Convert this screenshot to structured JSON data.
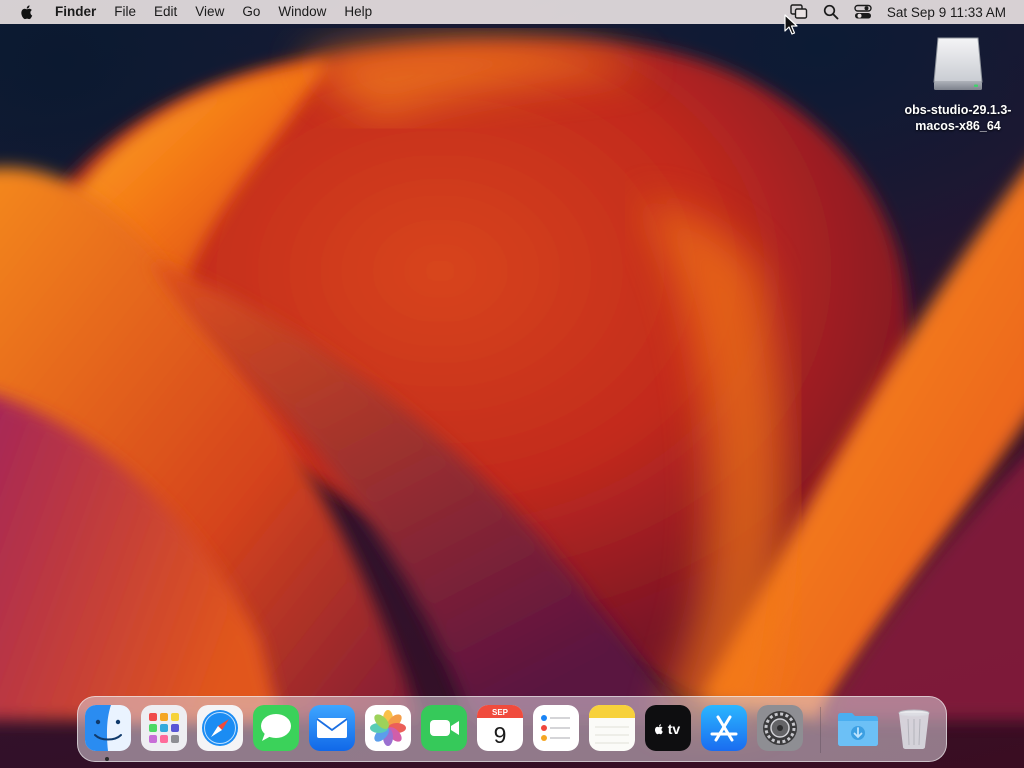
{
  "menubar": {
    "app_name": "Finder",
    "menus": [
      "File",
      "Edit",
      "View",
      "Go",
      "Window",
      "Help"
    ],
    "clock": "Sat Sep 9  11:33 AM",
    "status_icons": [
      "screen-mirroring-icon",
      "spotlight-search-icon",
      "control-center-icon"
    ]
  },
  "desktop": {
    "items": [
      {
        "label": "obs-studio-29.1.3-macos-x86_64",
        "icon": "disk-image-icon"
      }
    ]
  },
  "dock": {
    "apps": [
      {
        "name": "Finder",
        "icon": "finder-icon",
        "running": true
      },
      {
        "name": "Launchpad",
        "icon": "launchpad-icon",
        "running": false
      },
      {
        "name": "Safari",
        "icon": "safari-icon",
        "running": false
      },
      {
        "name": "Messages",
        "icon": "messages-icon",
        "running": false
      },
      {
        "name": "Mail",
        "icon": "mail-icon",
        "running": false
      },
      {
        "name": "Photos",
        "icon": "photos-icon",
        "running": false
      },
      {
        "name": "FaceTime",
        "icon": "facetime-icon",
        "running": false
      },
      {
        "name": "Calendar",
        "icon": "calendar-icon",
        "running": false,
        "month": "SEP",
        "day": "9"
      },
      {
        "name": "Reminders",
        "icon": "reminders-icon",
        "running": false
      },
      {
        "name": "Notes",
        "icon": "notes-icon",
        "running": false
      },
      {
        "name": "TV",
        "icon": "apple-tv-icon",
        "running": false,
        "label": "tv"
      },
      {
        "name": "App Store",
        "icon": "app-store-icon",
        "running": false
      },
      {
        "name": "System Settings",
        "icon": "system-settings-icon",
        "running": false
      },
      {
        "name": "Downloads",
        "icon": "downloads-folder-icon",
        "running": false
      },
      {
        "name": "Trash",
        "icon": "trash-icon",
        "running": false
      }
    ]
  },
  "colors": {
    "accent_blue": "#1a7cf5",
    "wallpaper_orange": "#f07818",
    "wallpaper_red": "#c8281c"
  }
}
